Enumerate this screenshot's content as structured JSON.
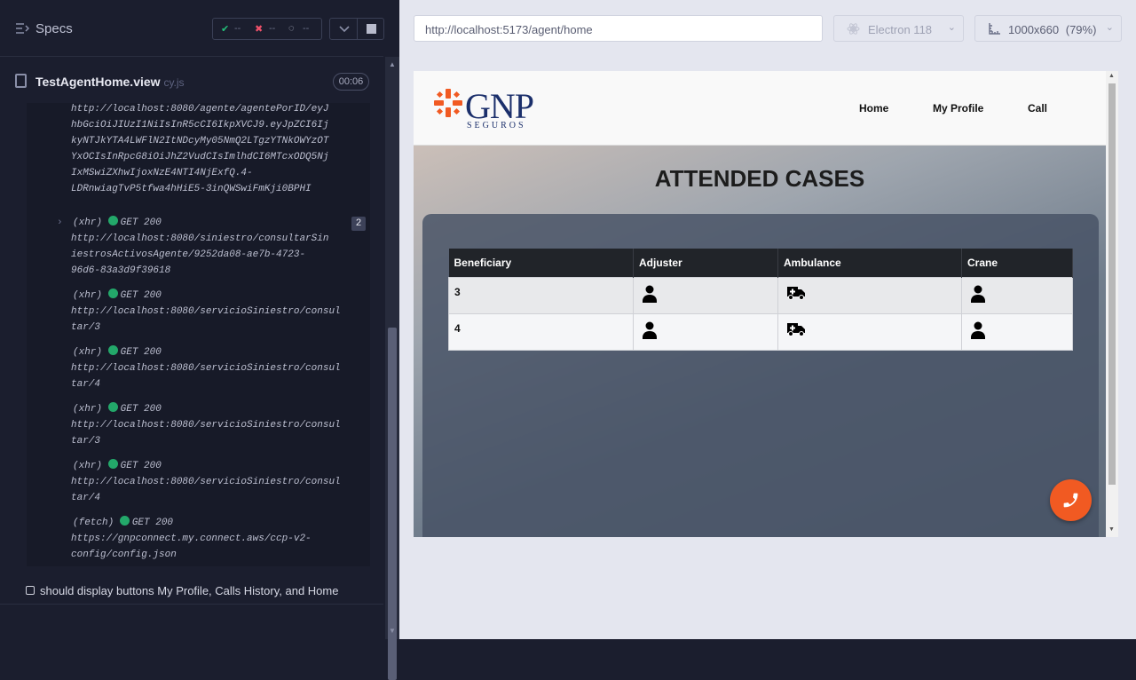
{
  "runner": {
    "specs_title": "Specs",
    "stats": {
      "passed": "--",
      "failed": "--",
      "pending": "--"
    },
    "file": {
      "name": "TestAgentHome.view",
      "ext": "cy.js",
      "time": "00:06"
    },
    "log": [
      {
        "type": "",
        "method": "",
        "url": "http://localhost:8080/agente/agentePorID/eyJ\nhbGciOiJIUzI1NiIsInR5cCI6IkpXVCJ9.eyJpZCI6Ij\nkyNTJkYTA4LWFlN2ItNDcyMy05NmQ2LTgzYTNkOWYzOT\nYxOCIsInRpcG8iOiJhZ2VudCIsImlhdCI6MTcxODQ5Nj\nIxMSwiZXhwIjoxNzE4NTI4NjExfQ.4-\nLDRnwiagTvP5tfwa4hHiE5-3inQWSwiFmKji0BPHI"
      },
      {
        "type": "(xhr)",
        "method": "GET 200",
        "count": "2",
        "url": "http://localhost:8080/siniestro/consultarSin\niestrosActivosAgente/9252da08-ae7b-4723-\n96d6-83a3d9f39618"
      },
      {
        "type": "(xhr)",
        "method": "GET 200",
        "url": "http://localhost:8080/servicioSiniestro/consul\ntar/3"
      },
      {
        "type": "(xhr)",
        "method": "GET 200",
        "url": "http://localhost:8080/servicioSiniestro/consul\ntar/4"
      },
      {
        "type": "(xhr)",
        "method": "GET 200",
        "url": "http://localhost:8080/servicioSiniestro/consul\ntar/3"
      },
      {
        "type": "(xhr)",
        "method": "GET 200",
        "url": "http://localhost:8080/servicioSiniestro/consul\ntar/4"
      },
      {
        "type": "(fetch)",
        "method": "GET 200",
        "url": "https://gnpconnect.my.connect.aws/ccp-v2-\nconfig/config.json"
      }
    ],
    "test_title": "should display buttons My Profile, Calls History, and Home"
  },
  "browser": {
    "url": "http://localhost:5173/agent/home",
    "engine": "Electron 118",
    "viewport": "1000x660",
    "zoom": "(79%)"
  },
  "app": {
    "logo": {
      "brand": "GNP",
      "sub": "SEGUROS"
    },
    "nav": {
      "home": "Home",
      "profile": "My Profile",
      "call": "Call"
    },
    "title": "ATTENDED CASES",
    "table": {
      "headers": [
        "Beneficiary",
        "Adjuster",
        "Ambulance",
        "Crane"
      ],
      "rows": [
        {
          "beneficiary": "3",
          "adjuster": "person-icon",
          "ambulance": "ambulance-icon",
          "crane": "person-icon"
        },
        {
          "beneficiary": "4",
          "adjuster": "person-icon",
          "ambulance": "ambulance-icon",
          "crane": "person-icon"
        }
      ]
    }
  },
  "colors": {
    "accent": "#f15a22",
    "brand": "#1b2f6b",
    "runner_bg": "#1b1e2e",
    "pass": "#23c07a"
  }
}
